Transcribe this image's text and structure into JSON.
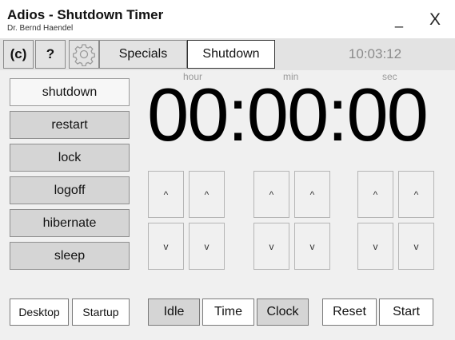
{
  "window": {
    "title": "Adios - Shutdown Timer",
    "author": "Dr. Bernd Haendel",
    "minimize_glyph": "_",
    "close_glyph": "X"
  },
  "toolbar": {
    "copyright_label": "(c)",
    "help_label": "?",
    "settings_icon": "gear-icon",
    "tabs": [
      {
        "label": "Specials",
        "active": false
      },
      {
        "label": "Shutdown",
        "active": true
      }
    ],
    "current_time": "10:03:12"
  },
  "actions": [
    {
      "label": "shutdown",
      "selected": true
    },
    {
      "label": "restart",
      "selected": false
    },
    {
      "label": "lock",
      "selected": false
    },
    {
      "label": "logoff",
      "selected": false
    },
    {
      "label": "hibernate",
      "selected": false
    },
    {
      "label": "sleep",
      "selected": false
    }
  ],
  "timer": {
    "hour_label": "hour",
    "min_label": "min",
    "sec_label": "sec",
    "display": "00:00:00",
    "up_glyph": "^",
    "down_glyph": "v"
  },
  "bottom": {
    "desktop_label": "Desktop",
    "startup_label": "Startup",
    "modes": [
      {
        "label": "Idle",
        "active": true
      },
      {
        "label": "Time",
        "active": false
      },
      {
        "label": "Clock",
        "active": true
      }
    ],
    "reset_label": "Reset",
    "start_label": "Start"
  },
  "colors": {
    "toolbar_bg": "#e3e3e3",
    "content_bg": "#f0f0f0",
    "button_grey": "#d5d5d5",
    "muted_text": "#8a8a8a"
  }
}
